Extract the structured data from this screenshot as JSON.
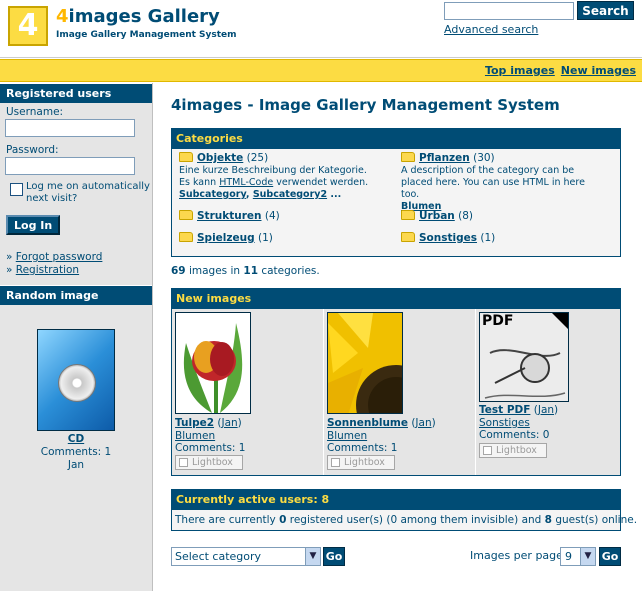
{
  "header": {
    "logo_mark": "4",
    "logo_title_num": "4",
    "logo_title_rest": "images Gallery",
    "logo_subtitle": "Image Gallery Management System",
    "search_button": "Search",
    "advanced_search": "Advanced search"
  },
  "topbar": {
    "top_images": "Top images",
    "new_images": "New images"
  },
  "sidebar": {
    "registered_title": "Registered users",
    "username_label": "Username:",
    "password_label": "Password:",
    "remember_label": "Log me on automatically next visit?",
    "login_button": "Log In",
    "links_prefix_1": "» ",
    "forgot_password": "Forgot password",
    "links_prefix_2": "» ",
    "registration": "Registration",
    "random_title": "Random image",
    "random_image": {
      "title": "CD",
      "comments": "Comments: 1",
      "user": "Jan"
    }
  },
  "main": {
    "page_title": "4images - Image Gallery Management System",
    "categories_title": "Categories",
    "categories": [
      {
        "name": "Objekte",
        "count": "(25)",
        "desc_1": "Eine kurze Beschreibung der Kategorie. Es kann ",
        "desc_link": "HTML-Code",
        "desc_2": " verwendet werden.",
        "sub_1": "Subcategory",
        "sub_sep": ", ",
        "sub_2": "Subcategory2",
        "sub_more": " ..."
      },
      {
        "name": "Pflanzen",
        "count": "(30)",
        "desc": "A description of the category can be placed here. You can use HTML in here too.",
        "sub_1": "Blumen"
      },
      {
        "name": "Strukturen",
        "count": "(4)"
      },
      {
        "name": "Urban",
        "count": "(8)"
      },
      {
        "name": "Spielzeug",
        "count": "(1)"
      },
      {
        "name": "Sonstiges",
        "count": "(1)"
      }
    ],
    "stats": {
      "image_count": "69",
      "mid_text": " images in ",
      "category_count": "11",
      "end_text": " categories."
    },
    "new_images_title": "New images",
    "new_images": [
      {
        "title": "Tulpe2",
        "user": "Jan",
        "category": "Blumen",
        "comments": "Comments: 1",
        "lightbox": "Lightbox"
      },
      {
        "title": "Sonnenblume",
        "user": "Jan",
        "category": "Blumen",
        "comments": "Comments: 1",
        "lightbox": "Lightbox"
      },
      {
        "title": "Test PDF",
        "user": "Jan",
        "category": "Sonstiges",
        "comments": "Comments: 0",
        "lightbox": "Lightbox"
      }
    ],
    "pdf_label": "PDF",
    "users_title": "Currently active users: 8",
    "users_text": {
      "t1": "There are currently ",
      "registered": "0",
      "t2": " registered user(s) (0 among them invisible) and ",
      "guests": "8",
      "t3": " guest(s) online."
    },
    "bottom": {
      "select_category": "Select category",
      "go_1": "Go",
      "per_page_label": "Images per page:",
      "per_page_value": "9",
      "go_2": "Go"
    }
  }
}
